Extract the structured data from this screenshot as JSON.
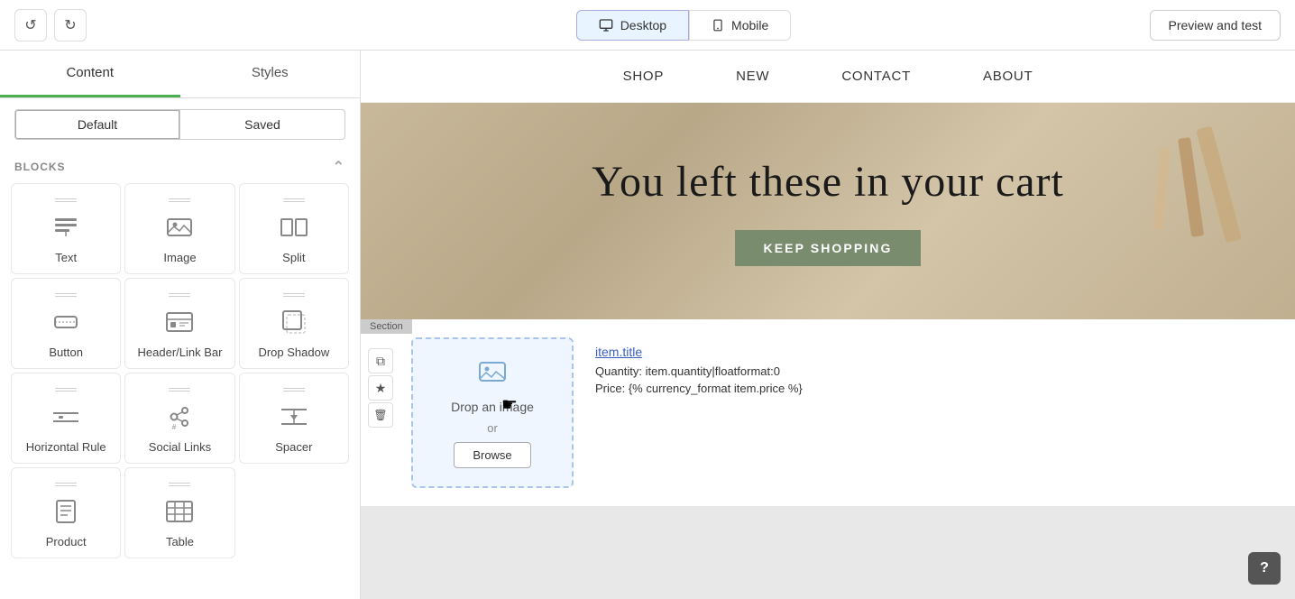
{
  "toolbar": {
    "undo_label": "↺",
    "redo_label": "↻",
    "desktop_label": "Desktop",
    "mobile_label": "Mobile",
    "preview_label": "Preview and test"
  },
  "sidebar": {
    "tab_content": "Content",
    "tab_styles": "Styles",
    "state_default": "Default",
    "state_saved": "Saved",
    "blocks_header": "BLOCKS",
    "blocks": [
      {
        "id": "text",
        "label": "Text",
        "icon": "T"
      },
      {
        "id": "image",
        "label": "Image",
        "icon": "IMG"
      },
      {
        "id": "split",
        "label": "Split",
        "icon": "SPLIT"
      },
      {
        "id": "button",
        "label": "Button",
        "icon": "BTN"
      },
      {
        "id": "header-link-bar",
        "label": "Header/Link Bar",
        "icon": "HDR"
      },
      {
        "id": "drop-shadow",
        "label": "Drop Shadow",
        "icon": "SHD"
      },
      {
        "id": "horizontal-rule",
        "label": "Horizontal Rule",
        "icon": "HR"
      },
      {
        "id": "social-links",
        "label": "Social Links",
        "icon": "SOC"
      },
      {
        "id": "spacer",
        "label": "Spacer",
        "icon": "SPC"
      },
      {
        "id": "product",
        "label": "Product",
        "icon": "PROD"
      },
      {
        "id": "table",
        "label": "Table",
        "icon": "TBL"
      }
    ]
  },
  "preview": {
    "navbar": {
      "items": [
        "SHOP",
        "NEW",
        "CONTACT",
        "ABOUT"
      ]
    },
    "hero": {
      "title": "You left these in your cart",
      "cta": "KEEP SHOPPING"
    },
    "section": {
      "label": "Section",
      "drop_image_text": "Drop an image",
      "or_text": "or",
      "browse_label": "Browse",
      "item_title": "item.title",
      "item_quantity": "Quantity: item.quantity|floatformat:0",
      "item_price": "Price: {% currency_format item.price %}"
    }
  },
  "section_actions": {
    "copy_icon": "⧉",
    "star_icon": "★",
    "delete_icon": "🗑"
  },
  "help": {
    "label": "?"
  }
}
